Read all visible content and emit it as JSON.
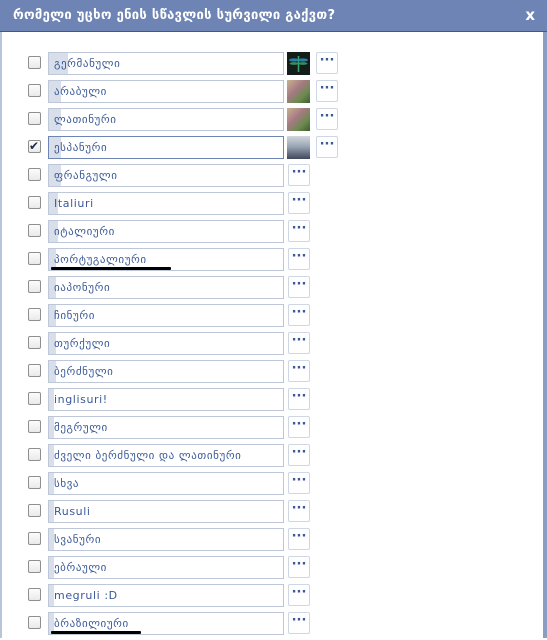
{
  "dialog": {
    "title": "რომელი უცხო ენის სწავლის სურვილი გაქვთ?",
    "close_label": "x",
    "more_label": "···"
  },
  "options": [
    {
      "label": "გერმანული",
      "checked": false,
      "fill": 0.08,
      "avatar": "dragonfly-photo"
    },
    {
      "label": "არაბული",
      "checked": false,
      "fill": 0.05,
      "avatar": "people-photo"
    },
    {
      "label": "ლათინური",
      "checked": false,
      "fill": 0.05,
      "avatar": "people-photo"
    },
    {
      "label": "ესპანური",
      "checked": true,
      "fill": 0.05,
      "avatar": "group-photo"
    },
    {
      "label": "ფრანგული",
      "checked": false,
      "fill": 0.05,
      "avatar": null
    },
    {
      "label": "Italiuri",
      "checked": false,
      "fill": 0.04,
      "avatar": null
    },
    {
      "label": "იტალიური",
      "checked": false,
      "fill": 0.04,
      "avatar": null
    },
    {
      "label": "პორტუგალიური",
      "checked": false,
      "fill": 0.03,
      "avatar": null,
      "underlined": true
    },
    {
      "label": "იაპონური",
      "checked": false,
      "fill": 0.03,
      "avatar": null
    },
    {
      "label": "ჩინური",
      "checked": false,
      "fill": 0.03,
      "avatar": null
    },
    {
      "label": "თურქული",
      "checked": false,
      "fill": 0.03,
      "avatar": null
    },
    {
      "label": "ბერძნული",
      "checked": false,
      "fill": 0.03,
      "avatar": null
    },
    {
      "label": "inglisuri!",
      "checked": false,
      "fill": 0.02,
      "avatar": null
    },
    {
      "label": "მეგრული",
      "checked": false,
      "fill": 0.02,
      "avatar": null
    },
    {
      "label": "ძველი ბერძნული და ლათინური",
      "checked": false,
      "fill": 0.02,
      "avatar": null
    },
    {
      "label": "სხვა",
      "checked": false,
      "fill": 0.02,
      "avatar": null
    },
    {
      "label": "Rusuli",
      "checked": false,
      "fill": 0.02,
      "avatar": null
    },
    {
      "label": "სვანური",
      "checked": false,
      "fill": 0.02,
      "avatar": null
    },
    {
      "label": "ებრაული",
      "checked": false,
      "fill": 0.02,
      "avatar": null
    },
    {
      "label": "megruli :D",
      "checked": false,
      "fill": 0.02,
      "avatar": null
    },
    {
      "label": "ბრაზილიური",
      "checked": false,
      "fill": 0.02,
      "avatar": null,
      "underlined": true
    }
  ]
}
